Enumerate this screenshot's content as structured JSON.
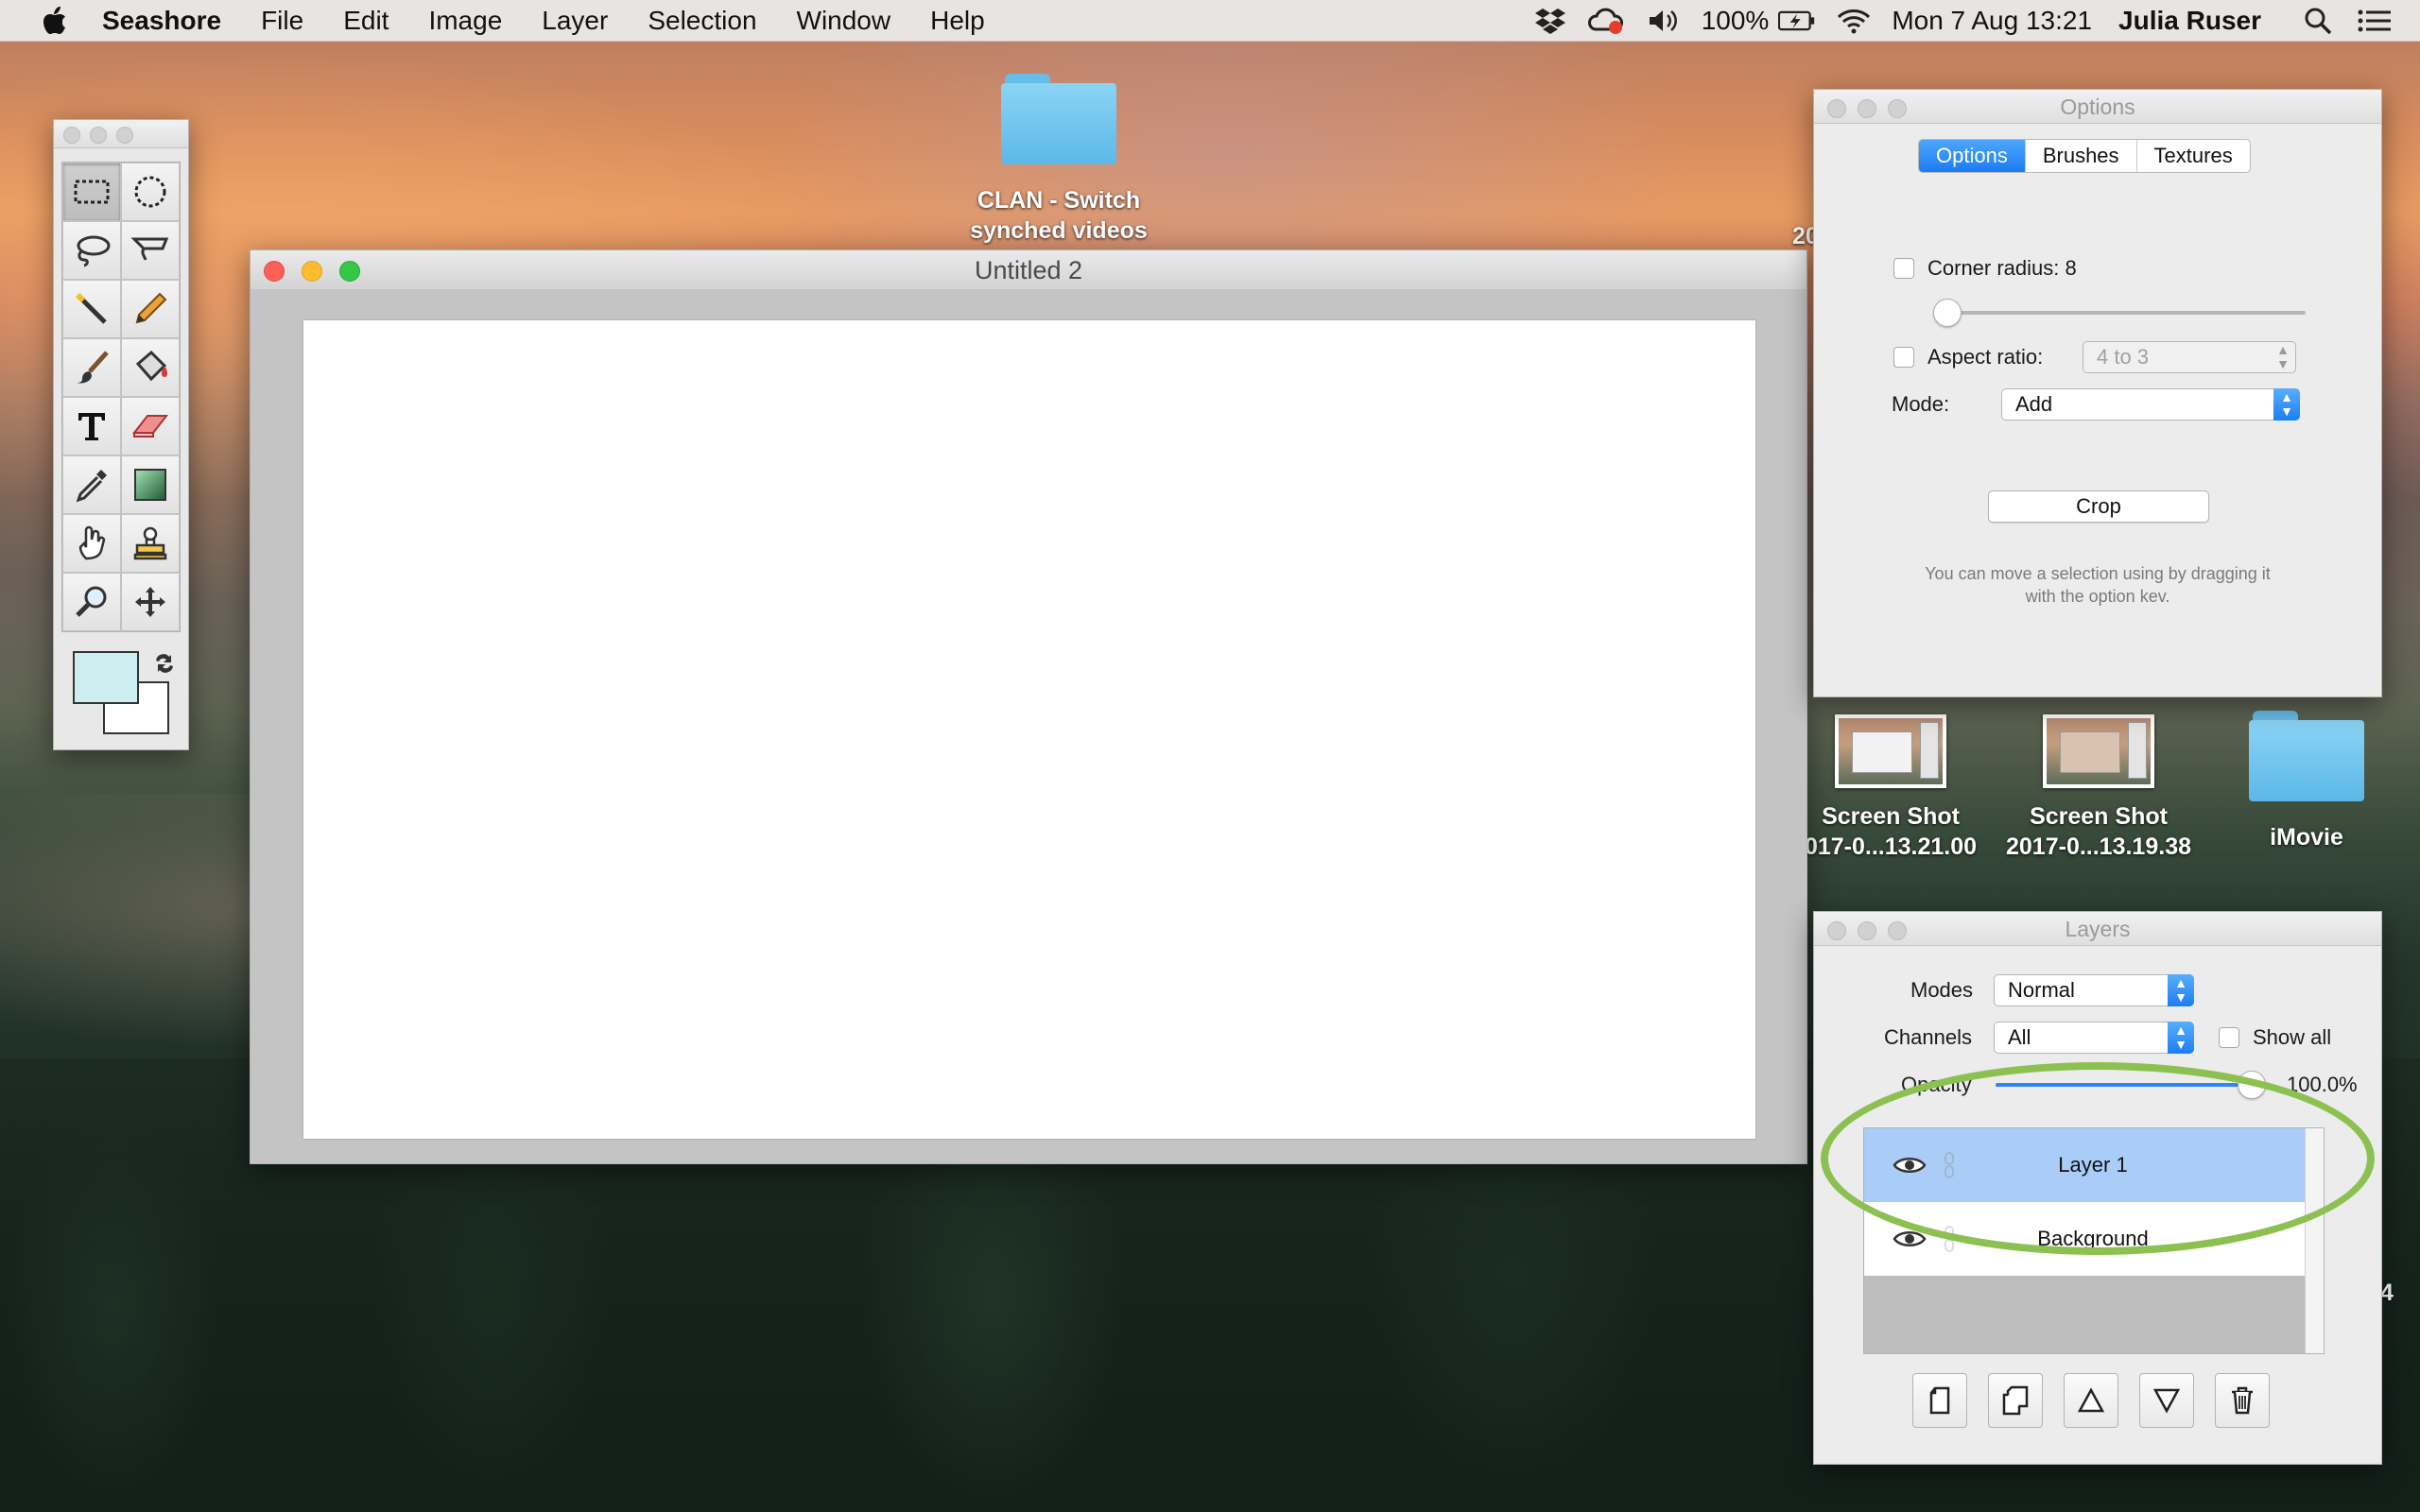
{
  "menubar": {
    "app_name": "Seashore",
    "items": [
      "File",
      "Edit",
      "Image",
      "Layer",
      "Selection",
      "Window",
      "Help"
    ],
    "battery": "100%",
    "datetime": "Mon 7 Aug  13:21",
    "user": "Julia Ruser"
  },
  "desktop": {
    "clan_folder": {
      "line1": "CLAN - Switch",
      "line2": "synched videos"
    },
    "screenshot1": {
      "line1": "Screen Shot",
      "line2": "017-0...13.21.00"
    },
    "screenshot2": {
      "line1": "Screen Shot",
      "line2": "2017-0...13.19.38"
    },
    "imovie": "iMovie",
    "edge_20": "20",
    "edge_4": "4"
  },
  "toolbox": {
    "tools": [
      "rect-select-icon",
      "ellipse-select-icon",
      "lasso-icon",
      "polygon-lasso-icon",
      "magic-wand-icon",
      "pencil-icon",
      "brush-icon",
      "bucket-icon",
      "text-icon",
      "eraser-icon",
      "eyedropper-icon",
      "gradient-icon",
      "smudge-icon",
      "clone-stamp-icon",
      "zoom-icon",
      "move-icon"
    ],
    "selected_tool": "rect-select-icon",
    "foreground_color": "#cdeef0",
    "background_color": "#ffffff"
  },
  "document": {
    "title": "Untitled 2"
  },
  "options_panel": {
    "title": "Options",
    "tabs": [
      "Options",
      "Brushes",
      "Textures"
    ],
    "active_tab": "Options",
    "corner_radius_label": "Corner radius: 8",
    "corner_radius_checked": false,
    "aspect_ratio_label": "Aspect ratio:",
    "aspect_ratio_value": "4 to 3",
    "mode_label": "Mode:",
    "mode_value": "Add",
    "crop_button": "Crop",
    "hint_line1": "You can move a selection using by dragging it",
    "hint_line2": "with the option kev."
  },
  "layers_panel": {
    "title": "Layers",
    "modes_label": "Modes",
    "modes_value": "Normal",
    "channels_label": "Channels",
    "channels_value": "All",
    "show_all_label": "Show all",
    "opacity_label": "Opacity",
    "opacity_value": "100.0%",
    "opacity_fraction": 1.0,
    "layers": [
      "Layer 1",
      "Background"
    ],
    "selected_layer": "Layer 1",
    "buttons": [
      "new-layer-icon",
      "duplicate-layer-icon",
      "raise-layer-icon",
      "lower-layer-icon",
      "trash-icon"
    ]
  },
  "colors": {
    "accent_blue": "#1b7cf3",
    "highlight_ring": "#8cc152",
    "selected_row": "#a9cdf6"
  }
}
